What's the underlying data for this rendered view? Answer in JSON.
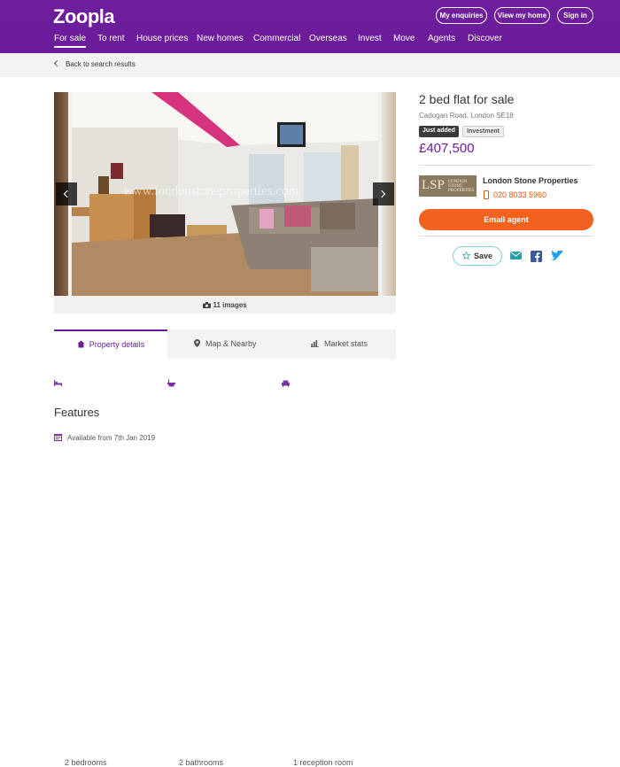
{
  "header": {
    "logo": "Zoopla",
    "buttons": [
      "My enquiries",
      "View my home",
      "Sign in"
    ],
    "nav": [
      "For sale",
      "To rent",
      "House prices",
      "New homes",
      "Commercial",
      "Overseas",
      "Invest",
      "Move",
      "Agents",
      "Discover"
    ]
  },
  "breadcrumb": {
    "back": "Back to search results"
  },
  "gallery": {
    "watermark": "www.londonstoneproperties.com",
    "count": "11 images"
  },
  "listing": {
    "title": "2 bed flat for sale",
    "address": "Cadogan Road, London SE18",
    "badges": [
      "Just added",
      "Investment"
    ],
    "price": "£407,500"
  },
  "agent": {
    "logo_letters": "LSP",
    "logo_text": "LONDON STONE PROPERTIES",
    "name": "London Stone Properties",
    "phone": "020 8033 5960",
    "cta": "Email agent"
  },
  "actions": {
    "save": "Save"
  },
  "tabs": [
    "Property details",
    "Map & Nearby",
    "Market stats"
  ],
  "facts": [
    "2 bedrooms",
    "2 bathrooms",
    "1 reception room"
  ],
  "features": {
    "heading": "Features",
    "items": [
      "Available from 7th Jan 2019"
    ]
  },
  "colors": {
    "brand": "#6a1b9a",
    "accent": "#f2611d",
    "save_border": "#7fcfd0",
    "badge_dark": "#3a3a3a"
  }
}
